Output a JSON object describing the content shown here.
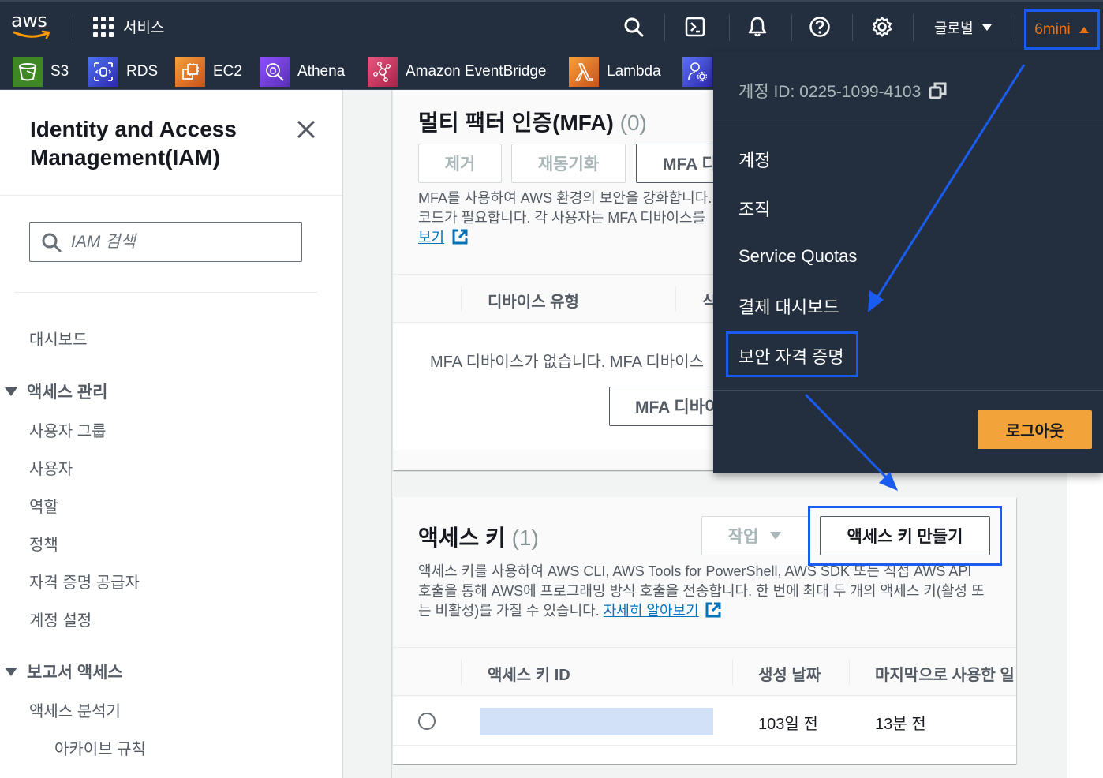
{
  "topnav": {
    "logo_text": "aws",
    "services_label": "서비스",
    "icons": [
      "search-icon",
      "cloudshell-icon",
      "notifications-bell-icon",
      "help-icon",
      "settings-gear-icon"
    ],
    "region_label": "글로벌",
    "account_label": "6mini"
  },
  "favorites": [
    {
      "label": "S3",
      "icon": "s3-bucket-icon",
      "color": "#3f8624"
    },
    {
      "label": "RDS",
      "icon": "rds-database-icon",
      "color": "#3b48cc"
    },
    {
      "label": "EC2",
      "icon": "ec2-chip-icon",
      "color": "#d86613"
    },
    {
      "label": "Athena",
      "icon": "athena-search-icon",
      "color": "#8c4fff"
    },
    {
      "label": "Amazon EventBridge",
      "icon": "eventbridge-icon",
      "color": "#c7395f"
    },
    {
      "label": "Lambda",
      "icon": "lambda-icon",
      "color": "#e07b1f"
    },
    {
      "label": "",
      "icon": "iam-user-settings-icon",
      "color": "#4d5cdb"
    }
  ],
  "sidebar": {
    "title": "Identity and Access Management(IAM)",
    "search_placeholder": "IAM 검색",
    "dashboard": "대시보드",
    "sections": [
      {
        "label": "액세스 관리",
        "items": [
          "사용자 그룹",
          "사용자",
          "역할",
          "정책",
          "자격 증명 공급자",
          "계정 설정"
        ]
      },
      {
        "label": "보고서 액세스",
        "items": [
          "액세스 분석기"
        ],
        "subitems": [
          "아카이브 규칙"
        ]
      }
    ]
  },
  "mfa_card": {
    "title": "멀티 팩터 인증(MFA)",
    "count": "(0)",
    "buttons": {
      "remove": "제거",
      "resync": "재동기화",
      "assign": "MFA 디바이스 할당"
    },
    "description_line1": "MFA를 사용하여 AWS 환경의 보안을 강화합니다.",
    "description_line2": "코드가 필요합니다. 각 사용자는 MFA 디바이스를",
    "link_label": "보기",
    "columns": [
      "디바이스 유형",
      "식별자"
    ],
    "empty_text": "MFA 디바이스가 없습니다. MFA 디바이스",
    "empty_button": "MFA 디바이스 할당"
  },
  "access_keys_card": {
    "title": "액세스 키",
    "count": "(1)",
    "actions_label": "작업",
    "create_label": "액세스 키 만들기",
    "description_line1": "액세스 키를 사용하여 AWS CLI, AWS Tools for PowerShell, AWS SDK 또는 직접 AWS API",
    "description_line2": "호출을 통해 AWS에 프로그래밍 방식 호출을 전송합니다. 한 번에 최대 두 개의 액세스 키(활성 또",
    "description_line3": "는 비활성)를 가질 수 있습니다.",
    "learn_more_label": "자세히 알아보기",
    "columns": [
      "액세스 키 ID",
      "생성 날짜",
      "마지막으로 사용한 일"
    ],
    "rows": [
      {
        "key_id": "",
        "created": "103일 전",
        "last_used": "13분 전"
      }
    ]
  },
  "account_menu": {
    "account_id_label": "계정 ID: 0225-1099-4103",
    "items": [
      "계정",
      "조직",
      "Service Quotas",
      "결제 대시보드",
      "보안 자격 증명"
    ],
    "highlighted_item": "보안 자격 증명",
    "logout_label": "로그아웃"
  },
  "colors": {
    "nav_bg": "#232f3e",
    "accent_orange": "#ec7211",
    "logout_orange": "#f2a33a",
    "annotation_blue": "#1a5cf0",
    "link_blue": "#0073bb",
    "redacted_key_fill": "#d3e1f8"
  }
}
